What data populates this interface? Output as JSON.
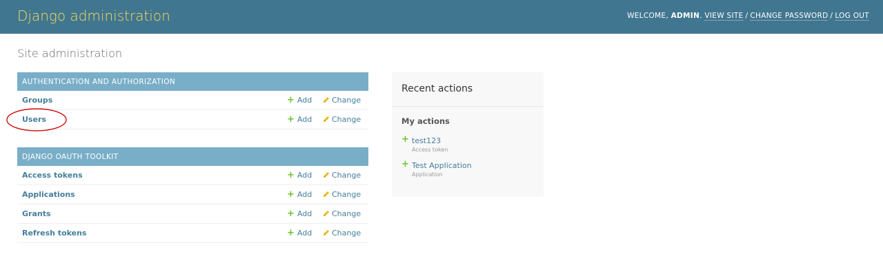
{
  "header": {
    "site_name": "Django administration",
    "welcome_label": "WELCOME,",
    "username": "ADMIN",
    "view_site": "VIEW SITE",
    "change_password": "CHANGE PASSWORD",
    "log_out": "LOG OUT",
    "separator": "/",
    "bg_color": "#417690",
    "brand_color": "#f5dd5d"
  },
  "page_title": "Site administration",
  "modules": [
    {
      "caption": "AUTHENTICATION AND AUTHORIZATION",
      "models": [
        {
          "name": "Groups",
          "add": "Add",
          "change": "Change"
        },
        {
          "name": "Users",
          "add": "Add",
          "change": "Change"
        }
      ]
    },
    {
      "caption": "DJANGO OAUTH TOOLKIT",
      "models": [
        {
          "name": "Access tokens",
          "add": "Add",
          "change": "Change"
        },
        {
          "name": "Applications",
          "add": "Add",
          "change": "Change"
        },
        {
          "name": "Grants",
          "add": "Add",
          "change": "Change"
        },
        {
          "name": "Refresh tokens",
          "add": "Add",
          "change": "Change"
        }
      ]
    }
  ],
  "recent_actions": {
    "title": "Recent actions",
    "my_actions_title": "My actions",
    "items": [
      {
        "icon": "plus-icon",
        "label": "test123",
        "type": "Access token"
      },
      {
        "icon": "plus-icon",
        "label": "Test Application",
        "type": "Application"
      }
    ]
  },
  "colors": {
    "caption_bg": "#79aec8",
    "link": "#447e9b",
    "add_icon": "#70bf2b",
    "highlight_annotation": "#d01010"
  }
}
